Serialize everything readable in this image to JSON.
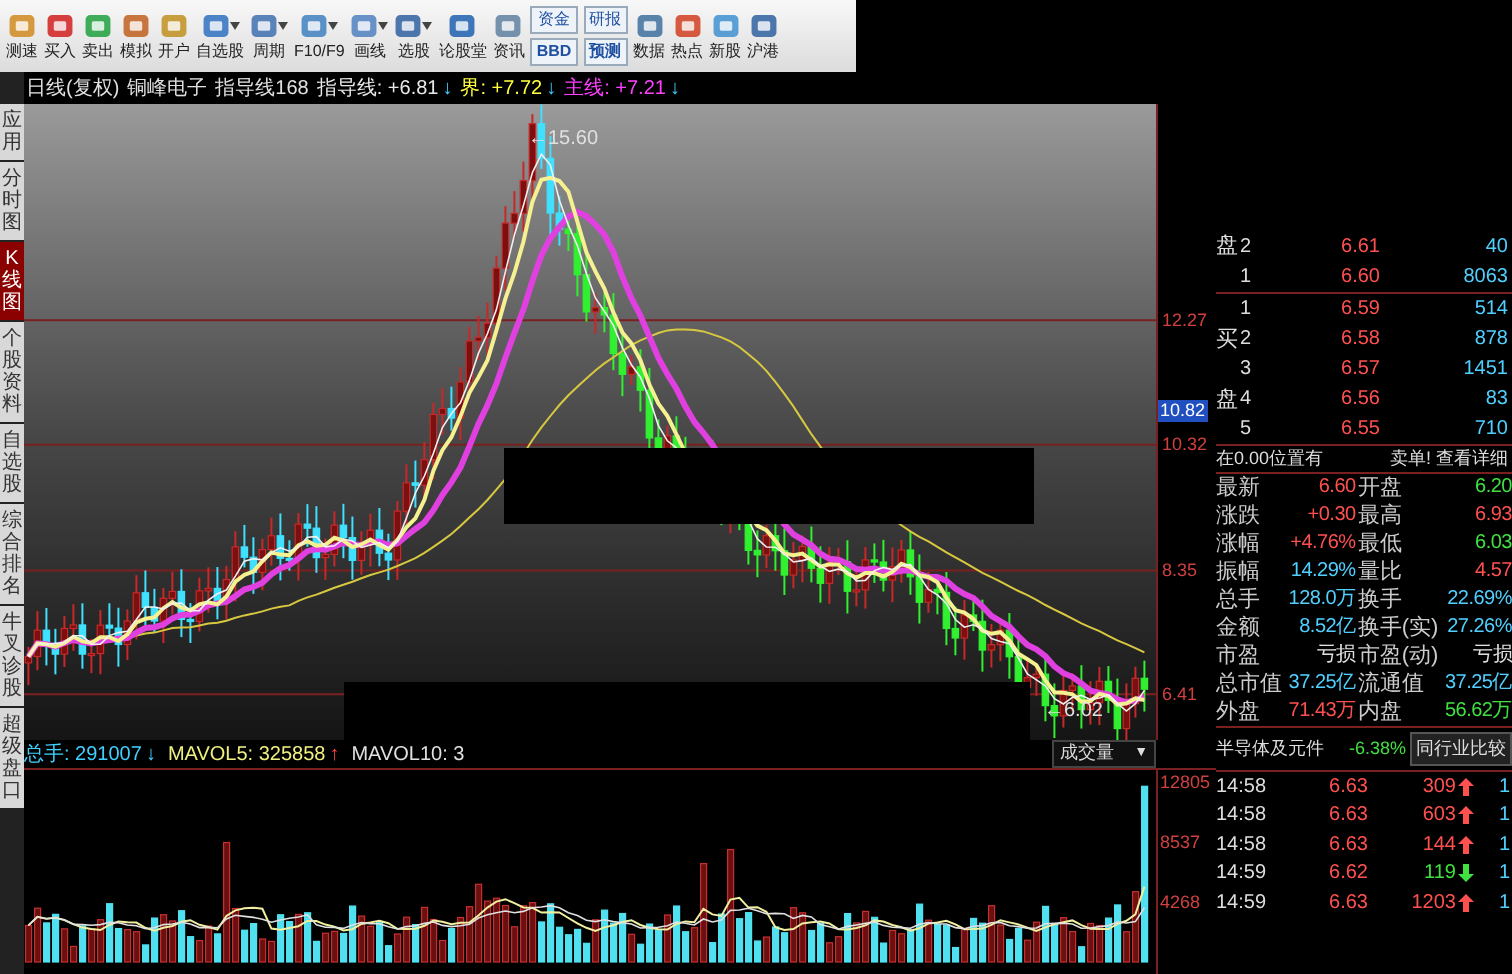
{
  "toolbar": [
    {
      "label": "测速",
      "dropdown": false
    },
    {
      "label": "买入",
      "dropdown": false
    },
    {
      "label": "卖出",
      "dropdown": false
    },
    {
      "label": "模拟",
      "dropdown": false
    },
    {
      "label": "开户",
      "dropdown": false
    },
    {
      "label": "自选股",
      "dropdown": true
    },
    {
      "label": "周期",
      "dropdown": true
    },
    {
      "label": "F10/F9",
      "dropdown": true
    },
    {
      "label": "画线",
      "dropdown": true
    },
    {
      "label": "选股",
      "dropdown": true
    },
    {
      "label": "论股堂",
      "dropdown": false
    },
    {
      "label": "资讯",
      "dropdown": false
    },
    {
      "kind": "stack",
      "top": "资金",
      "bottom": "BBD"
    },
    {
      "kind": "stack",
      "top": "研报",
      "bottom": "预测"
    },
    {
      "label": "数据",
      "dropdown": false
    },
    {
      "label": "热点",
      "dropdown": false
    },
    {
      "label": "新股",
      "dropdown": false
    },
    {
      "label": "沪港",
      "dropdown": false
    }
  ],
  "info_line": {
    "period": "日线(复权)",
    "stock": "铜峰电子",
    "indicator": "指导线168",
    "values": [
      {
        "label": "指导线: +6.81",
        "arrow": "↓",
        "kind": "guide"
      },
      {
        "label": "界: +7.72",
        "arrow": "↓",
        "kind": "boundary"
      },
      {
        "label": "主线: +7.21",
        "arrow": "↓",
        "kind": "main"
      }
    ]
  },
  "side_tabs": [
    {
      "label": "应用",
      "selected": false
    },
    {
      "label": "分时图",
      "selected": false
    },
    {
      "label": "K线图",
      "selected": true
    },
    {
      "label": "个股资料",
      "selected": false
    },
    {
      "label": "自选股",
      "selected": false
    },
    {
      "label": "综合排名",
      "selected": false
    },
    {
      "label": "牛叉诊股",
      "selected": false
    },
    {
      "label": "超级盘口",
      "selected": false
    }
  ],
  "price_chart": {
    "high_label": "←15.60",
    "low_label": "←6.02",
    "price_labels": [
      "12.27",
      "10.32",
      "8.35",
      "6.41"
    ],
    "current_price": "10.82"
  },
  "volume_chart": {
    "total": "总手: 291007",
    "total_arrow": "↓",
    "mavol5": "MAVOL5: 325858",
    "mavol5_arrow": "↑",
    "mavol10": "MAVOL10: 3",
    "selector": "成交量",
    "selector_caret": "▼",
    "ticks": [
      "12805",
      "8537",
      "4268"
    ]
  },
  "order_book": {
    "sell_label": "盘",
    "sell": [
      {
        "level": "2",
        "price": "6.61",
        "volume": "40"
      },
      {
        "level": "1",
        "price": "6.60",
        "volume": "8063"
      }
    ],
    "buy_label": "买盘",
    "buy": [
      {
        "level": "1",
        "price": "6.59",
        "volume": "514"
      },
      {
        "level": "2",
        "price": "6.58",
        "volume": "878"
      },
      {
        "level": "3",
        "price": "6.57",
        "volume": "1451"
      },
      {
        "level": "4",
        "price": "6.56",
        "volume": "83"
      },
      {
        "level": "5",
        "price": "6.55",
        "volume": "710"
      }
    ],
    "notice": "在0.00位置有",
    "notice_link": "卖单! 查看详细"
  },
  "stats": [
    {
      "label": "最新",
      "value": "6.60",
      "color": "#ff5050"
    },
    {
      "label": "开盘",
      "value": "6.20",
      "color": "#40e040"
    },
    {
      "label": "涨跌",
      "value": "+0.30",
      "color": "#ff5050"
    },
    {
      "label": "最高",
      "value": "6.93",
      "color": "#ff5050"
    },
    {
      "label": "涨幅",
      "value": "+4.76%",
      "color": "#ff5050"
    },
    {
      "label": "最低",
      "value": "6.03",
      "color": "#40e040"
    },
    {
      "label": "振幅",
      "value": "14.29%",
      "color": "#50d0ff"
    },
    {
      "label": "量比",
      "value": "4.57",
      "color": "#ff5050"
    },
    {
      "label": "总手",
      "value": "128.0万",
      "color": "#50d0ff"
    },
    {
      "label": "换手",
      "value": "22.69%",
      "color": "#50d0ff"
    },
    {
      "label": "金额",
      "value": "8.52亿",
      "color": "#50d0ff"
    },
    {
      "label": "换手(实)",
      "value": "27.26%",
      "color": "#50d0ff"
    },
    {
      "label": "市盈",
      "value": "亏损",
      "color": "#e0e0e0"
    },
    {
      "label": "市盈(动)",
      "value": "亏损",
      "color": "#e0e0e0"
    },
    {
      "label": "总市值",
      "value": "37.25亿",
      "color": "#50d0ff"
    },
    {
      "label": "流通值",
      "value": "37.25亿",
      "color": "#50d0ff"
    },
    {
      "label": "外盘",
      "value": "71.43万",
      "color": "#ff5050"
    },
    {
      "label": "内盘",
      "value": "56.62万",
      "color": "#40e040"
    }
  ],
  "sector": {
    "name": "半导体及元件",
    "change": "-6.38%",
    "compare_button": "同行业比较"
  },
  "ticks": [
    {
      "time": "14:58",
      "price": "6.63",
      "volume": "309",
      "rising": true,
      "trailing": "1"
    },
    {
      "time": "14:58",
      "price": "6.63",
      "volume": "603",
      "rising": true,
      "trailing": "1"
    },
    {
      "time": "14:58",
      "price": "6.63",
      "volume": "144",
      "rising": true,
      "trailing": "1"
    },
    {
      "time": "14:59",
      "price": "6.62",
      "volume": "119",
      "rising": false,
      "trailing": "1"
    },
    {
      "time": "14:59",
      "price": "6.63",
      "volume": "1203",
      "rising": true,
      "trailing": "1"
    }
  ]
}
